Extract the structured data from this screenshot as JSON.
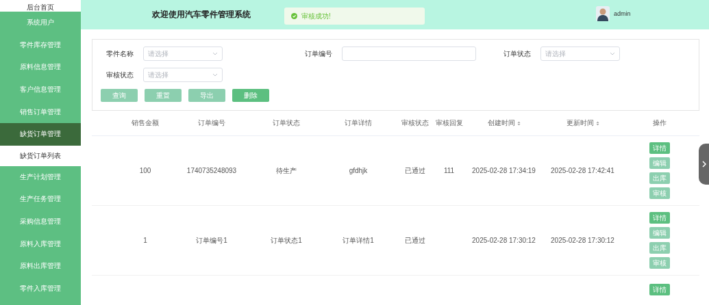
{
  "sidebar": {
    "items": [
      {
        "label": "后台首页",
        "selected": false,
        "kind": "top"
      },
      {
        "label": "系统用户",
        "selected": false,
        "kind": "menu"
      },
      {
        "label": "零件库存管理",
        "selected": false,
        "kind": "menu"
      },
      {
        "label": "原料信息管理",
        "selected": false,
        "kind": "menu"
      },
      {
        "label": "客户信息管理",
        "selected": false,
        "kind": "menu"
      },
      {
        "label": "销售订单管理",
        "selected": false,
        "kind": "menu"
      },
      {
        "label": "缺货订单管理",
        "selected": true,
        "kind": "menu"
      },
      {
        "label": "缺货订单列表",
        "selected": false,
        "kind": "sub"
      },
      {
        "label": "生产计划管理",
        "selected": false,
        "kind": "menu"
      },
      {
        "label": "生产任务管理",
        "selected": false,
        "kind": "menu"
      },
      {
        "label": "采购信息管理",
        "selected": false,
        "kind": "menu"
      },
      {
        "label": "原料入库管理",
        "selected": false,
        "kind": "menu"
      },
      {
        "label": "原料出库管理",
        "selected": false,
        "kind": "menu"
      },
      {
        "label": "零件入库管理",
        "selected": false,
        "kind": "menu"
      }
    ]
  },
  "header": {
    "title": "欢迎使用汽车零件管理系统",
    "toast": "审核成功!",
    "user": "admin"
  },
  "filters": [
    {
      "label": "零件名称",
      "kind": "select",
      "placeholder": "请选择"
    },
    {
      "label": "订单编号",
      "kind": "input"
    },
    {
      "label": "订单状态",
      "kind": "select",
      "placeholder": "请选择"
    },
    {
      "label": "审核状态",
      "kind": "select",
      "placeholder": "请选择"
    }
  ],
  "filter_buttons": [
    {
      "label": "查询",
      "kind": "light"
    },
    {
      "label": "重置",
      "kind": "light"
    },
    {
      "label": "导出",
      "kind": "light"
    },
    {
      "label": "删除",
      "kind": "primary"
    }
  ],
  "table": {
    "columns": [
      {
        "label": "销售金额",
        "sortable": false
      },
      {
        "label": "订单编号",
        "sortable": false
      },
      {
        "label": "订单状态",
        "sortable": false
      },
      {
        "label": "订单详情",
        "sortable": false
      },
      {
        "label": "审核状态",
        "sortable": false
      },
      {
        "label": "审核回复",
        "sortable": false
      },
      {
        "label": "创建时间",
        "sortable": true
      },
      {
        "label": "更新时间",
        "sortable": true
      },
      {
        "label": "操作",
        "sortable": false
      }
    ],
    "rows": [
      {
        "cells": [
          "100",
          "1740735248093",
          "待生产",
          "gfdhjk",
          "已通过",
          "111",
          "2025-02-28 17:34:19",
          "2025-02-28 17:42:41"
        ],
        "actions": [
          {
            "label": "详情",
            "kind": "primary"
          },
          {
            "label": "编辑",
            "kind": "light"
          },
          {
            "label": "出库",
            "kind": "light"
          },
          {
            "label": "审核",
            "kind": "light"
          }
        ]
      },
      {
        "cells": [
          "1",
          "订单编号1",
          "订单状态1",
          "订单详情1",
          "已通过",
          "",
          "2025-02-28 17:30:12",
          "2025-02-28 17:30:12"
        ],
        "actions": [
          {
            "label": "详情",
            "kind": "primary"
          },
          {
            "label": "编辑",
            "kind": "light"
          },
          {
            "label": "出库",
            "kind": "light"
          },
          {
            "label": "审核",
            "kind": "light"
          }
        ]
      },
      {
        "cells": [],
        "actions": [
          {
            "label": "详情",
            "kind": "primary"
          }
        ]
      }
    ]
  }
}
